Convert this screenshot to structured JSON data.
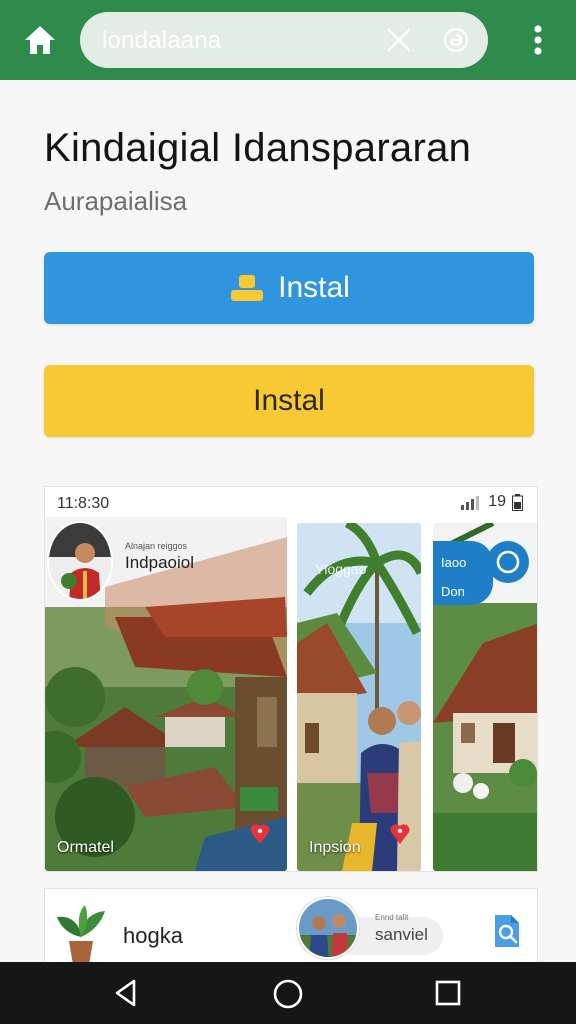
{
  "browser": {
    "url_text": "londalaana",
    "accent": "#2e8b4c"
  },
  "page": {
    "title": "Kindaigial Idanspararan",
    "subtitle": "Aurapaialisa"
  },
  "buttons": {
    "primary_label": "Instal",
    "secondary_label": "Instal",
    "primary_color": "#2f95de",
    "secondary_color": "#f9c933"
  },
  "screenshots": {
    "status_time": "11:8:30",
    "status_right": "19",
    "panel1_label_small": "Alnajan reiggos",
    "panel1_label": "Indpaoiol",
    "panel1_caption": "Ormatel",
    "panel2_label": "Yloggao",
    "panel2_caption": "Inpsion",
    "panel3_badge_top": "Iaoo",
    "panel3_badge_bottom": "Don"
  },
  "list_item": {
    "title": "hogka",
    "chip_label_small": "Ennd talit",
    "chip_label": "sanviel"
  },
  "icons": [
    "home-icon",
    "close-icon",
    "extension-icon",
    "more-vert-icon",
    "user-icon",
    "signal-icon",
    "battery-icon",
    "heart-pin-icon",
    "plant-icon",
    "search-doc-icon",
    "back-icon",
    "home-circle-icon",
    "recent-apps-icon"
  ]
}
